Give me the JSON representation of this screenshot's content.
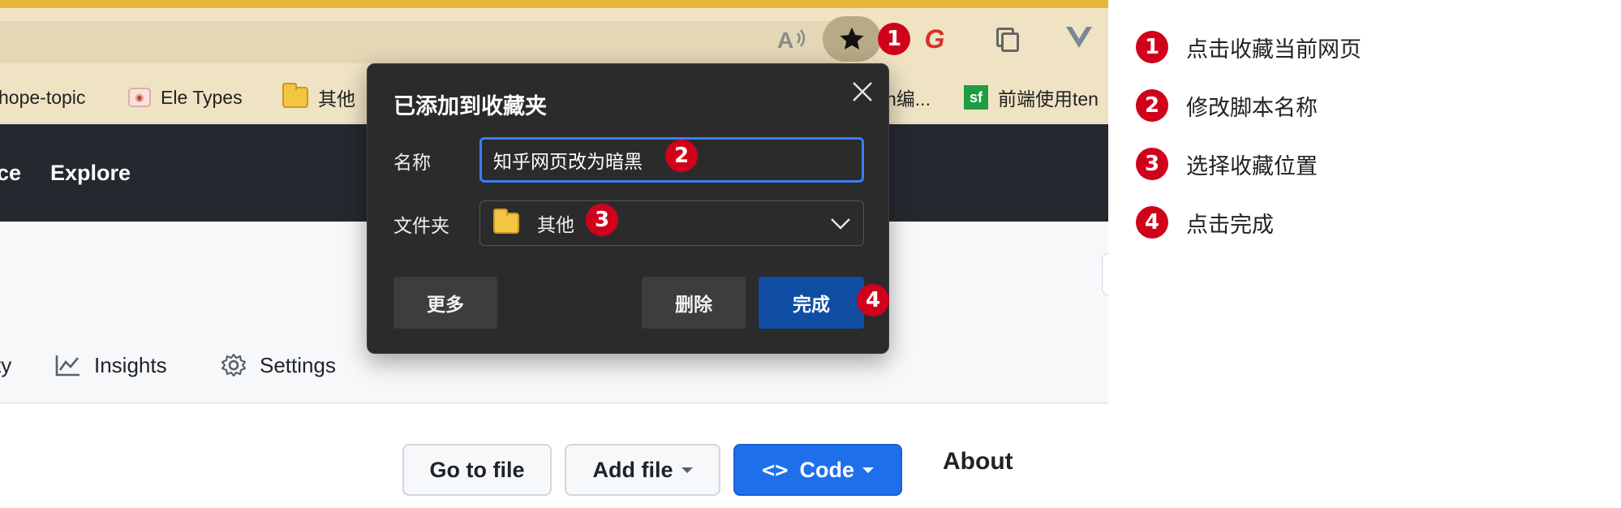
{
  "browser": {
    "bookmarks": [
      {
        "label": "hope-topic",
        "icon": "none"
      },
      {
        "label": "Ele Types",
        "icon": "tv-icon"
      },
      {
        "label": "其他",
        "icon": "folder-icon"
      },
      {
        "label": "n编...",
        "icon": "none"
      },
      {
        "label": "前端使用ten",
        "icon": "sf-icon"
      }
    ],
    "sf_icon_text": "sf",
    "g_icon_text": "G"
  },
  "github": {
    "nav": [
      "ce",
      "Explore"
    ],
    "tabs": [
      {
        "label": "ty",
        "icon": "none"
      },
      {
        "label": "Insights",
        "icon": "graph-icon"
      },
      {
        "label": "Settings",
        "icon": "gear-icon"
      }
    ],
    "buttons": {
      "go_to_file": "Go to file",
      "add_file": "Add file",
      "code": "Code",
      "code_icon": "<>"
    },
    "about": "About"
  },
  "dialog": {
    "title": "已添加到收藏夹",
    "name_label": "名称",
    "name_value": "知乎网页改为暗黑",
    "folder_label": "文件夹",
    "folder_value": "其他",
    "more_label": "更多",
    "delete_label": "删除",
    "done_label": "完成"
  },
  "badges": [
    "1",
    "2",
    "3",
    "4"
  ],
  "steps": [
    {
      "number": "1",
      "text": "点击收藏当前网页"
    },
    {
      "number": "2",
      "text": "修改脚本名称"
    },
    {
      "number": "3",
      "text": "选择收藏位置"
    },
    {
      "number": "4",
      "text": "点击完成"
    }
  ],
  "colors": {
    "badge": "#d0021b",
    "accent_blue": "#1f6feb",
    "dialog_bg": "#2b2b2b",
    "done_button": "#0f4ea3",
    "browser_chrome": "#efe3c4",
    "github_header": "#24292f"
  }
}
